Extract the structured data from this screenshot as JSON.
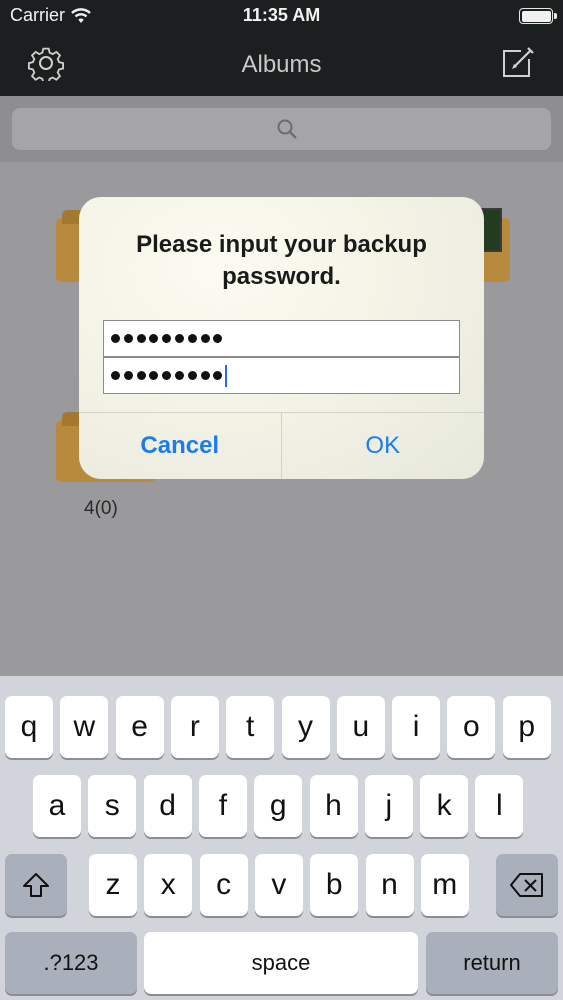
{
  "status": {
    "carrier": "Carrier",
    "time": "11:35 AM"
  },
  "nav": {
    "title": "Albums",
    "left_icon": "gear-icon",
    "right_icon": "compose-icon"
  },
  "search": {
    "icon": "search-icon"
  },
  "content": {
    "album_count": "4(0)"
  },
  "alert": {
    "title": "Please input your backup password.",
    "field1": {
      "value": "•••••••••",
      "dot_count": 9
    },
    "field2": {
      "value": "•••••••••",
      "dot_count": 9
    },
    "cancel_label": "Cancel",
    "ok_label": "OK"
  },
  "keyboard": {
    "row1": [
      "q",
      "w",
      "e",
      "r",
      "t",
      "y",
      "u",
      "i",
      "o",
      "p"
    ],
    "row2": [
      "a",
      "s",
      "d",
      "f",
      "g",
      "h",
      "j",
      "k",
      "l"
    ],
    "row3": [
      "z",
      "x",
      "c",
      "v",
      "b",
      "n",
      "m"
    ],
    "numbers_label": ".?123",
    "space_label": "space",
    "return_label": "return"
  },
  "colors": {
    "accent": "#1b7cf0",
    "nav_bg": "#1c1f1f",
    "keyboard_bg": "#d1d4da"
  }
}
